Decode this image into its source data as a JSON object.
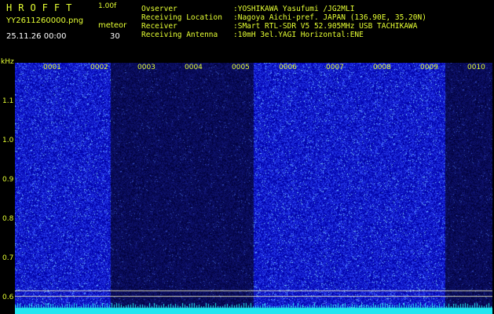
{
  "header": {
    "brand": "HROFFT",
    "version": "1.00f",
    "filename": "YY2611260000.png",
    "datetime": "25.11.26 00:00",
    "meteor_label": "meteor",
    "meteor_count": "30"
  },
  "info": {
    "rows": [
      {
        "key": "Ovserver",
        "value": ":YOSHIKAWA Yasufumi /JG2MLI"
      },
      {
        "key": "Receiving Location",
        "value": ":Nagoya Aichi-pref. JAPAN (136.90E, 35.20N)"
      },
      {
        "key": "Receiver",
        "value": ":SMart RTL-SDR V5 52.905MHz USB TACHIKAWA"
      },
      {
        "key": "Receiving Antenna",
        "value": ":10mH 3el.YAGI Horizontal:ENE"
      }
    ]
  },
  "axis": {
    "unit": "kHz",
    "ticks": [
      "1.1",
      "1.0",
      "0.9",
      "0.8",
      "0.7",
      "0.6"
    ]
  },
  "columns": [
    "0001",
    "0002",
    "0003",
    "0004",
    "0005",
    "0006",
    "0007",
    "0008",
    "0009",
    "0010"
  ],
  "colors": {
    "label": "#e6ff33",
    "bright": "#1e34e0",
    "dark": "#0b0f66",
    "baseline": "#22e6f0"
  },
  "bright_segments": [
    1,
    1,
    0,
    0,
    0,
    1,
    1,
    1,
    1,
    0
  ]
}
